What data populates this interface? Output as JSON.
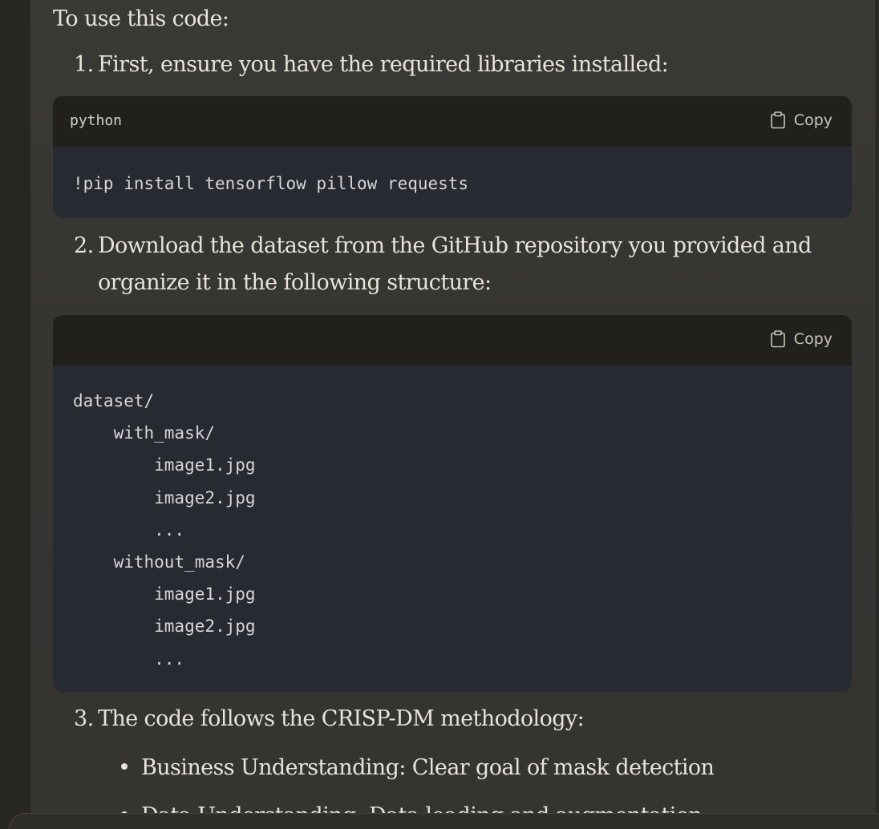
{
  "intro": "To use this code:",
  "steps": [
    {
      "num": "1.",
      "text": "First, ensure you have the required libraries installed:"
    },
    {
      "num": "2.",
      "text_line1": "Download the dataset from the GitHub repository you provided and",
      "text_line2": "organize it in the following structure:"
    },
    {
      "num": "3.",
      "text": "The code follows the CRISP-DM methodology:"
    }
  ],
  "code_blocks": [
    {
      "language": "python",
      "copy_label": "Copy",
      "lines": [
        "!pip install tensorflow pillow requests"
      ]
    },
    {
      "language": "",
      "copy_label": "Copy",
      "lines": [
        "dataset/",
        "    with_mask/",
        "        image1.jpg",
        "        image2.jpg",
        "        ...",
        "    without_mask/",
        "        image1.jpg",
        "        image2.jpg",
        "        ..."
      ]
    }
  ],
  "bullets": [
    "Business Understanding: Clear goal of mask detection",
    "Data Understanding: Data loading and augmentation"
  ],
  "colors": {
    "page_bg": "#2b2a27",
    "message_bg": "#383733",
    "code_header_bg": "#21201c",
    "code_body_bg": "#282a31",
    "text": "#e8e4dc"
  },
  "icons": {
    "copy": "clipboard-icon"
  }
}
